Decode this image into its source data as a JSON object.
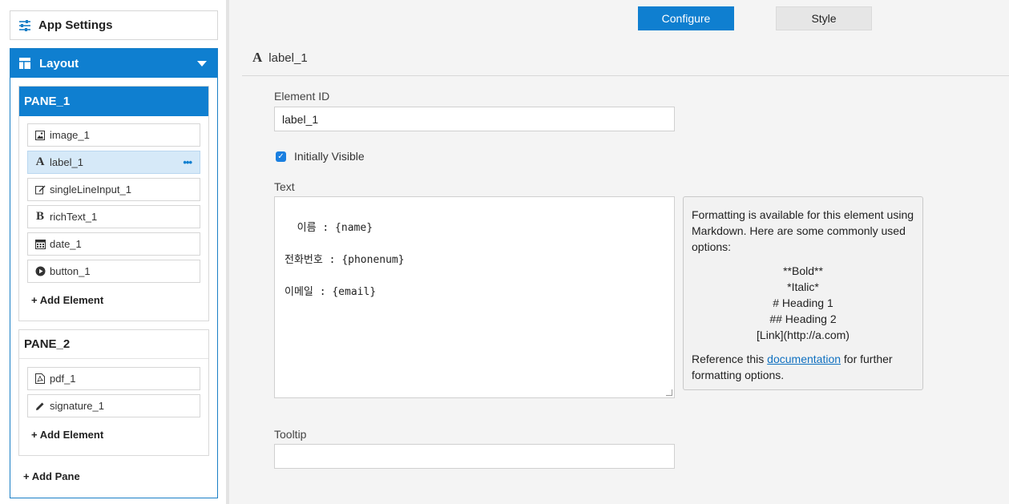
{
  "sidebar": {
    "app_settings_label": "App Settings",
    "layout_label": "Layout",
    "panes": [
      {
        "title": "PANE_1",
        "elements": [
          {
            "label": "image_1",
            "icon": "image-icon"
          },
          {
            "label": "label_1",
            "icon": "label-icon",
            "selected": true,
            "more": "•••"
          },
          {
            "label": "singleLineInput_1",
            "icon": "edit-icon"
          },
          {
            "label": "richText_1",
            "icon": "bold-icon"
          },
          {
            "label": "date_1",
            "icon": "calendar-icon"
          },
          {
            "label": "button_1",
            "icon": "play-circle-icon"
          }
        ],
        "add_element_label": "+ Add Element"
      },
      {
        "title": "PANE_2",
        "elements": [
          {
            "label": "pdf_1",
            "icon": "pdf-icon"
          },
          {
            "label": "signature_1",
            "icon": "pencil-icon"
          }
        ],
        "add_element_label": "+ Add Element"
      }
    ],
    "add_pane_label": "+ Add Pane"
  },
  "tabs": {
    "configure": "Configure",
    "style": "Style",
    "active": "Configure"
  },
  "element": {
    "title": "label_1",
    "id_label": "Element ID",
    "id_value": "label_1",
    "initially_visible_label": "Initially Visible",
    "initially_visible": true,
    "text_label": "Text",
    "text_value": "이름 : {name}\n\n전화번호 : {phonenum}\n\n이메일 : {email}",
    "tooltip_label": "Tooltip",
    "tooltip_value": ""
  },
  "help": {
    "intro": "Formatting is available for this element using Markdown. Here are some commonly used options:",
    "examples": [
      "**Bold**",
      "*Italic*",
      "# Heading 1",
      "## Heading 2",
      "[Link](http://a.com)"
    ],
    "ref_before": "Reference this ",
    "ref_link": "documentation",
    "ref_after": " for further formatting options."
  },
  "colors": {
    "accent": "#0f7fd0",
    "selected_bg": "#d6e9f8",
    "link": "#0f70c0"
  }
}
